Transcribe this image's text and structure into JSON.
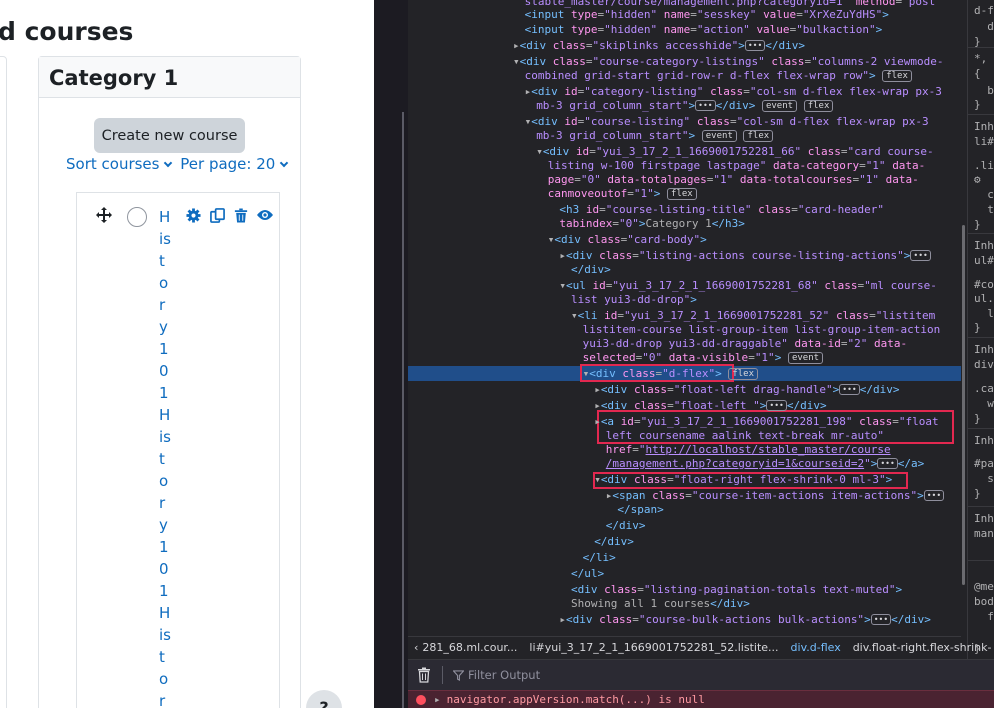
{
  "page": {
    "heading": "d courses",
    "category_title": "Category 1",
    "create_button": "Create new course",
    "sort_label": "Sort courses",
    "perpage_label": "Per page: 20",
    "course_name_chars": [
      "H",
      "is",
      "t",
      "o",
      "r",
      "y",
      "1",
      "0",
      "1",
      "H",
      "is",
      "t",
      "o",
      "r",
      "y",
      "1",
      "0",
      "1",
      "H",
      "is",
      "t",
      "o",
      "r"
    ],
    "help_label": "?"
  },
  "devtools": {
    "lines": [
      {
        "t": -5,
        "i": 11,
        "h": "<span class='val'>stable_master/course/management.php?categoryid=1</span>\" <span class='attr'>method</span>=<span class='val'>\"post\"</span>"
      },
      {
        "t": 8,
        "i": 11,
        "h": "<span class='tag'>&lt;input</span> <span class='attr'>type</span>=<span class='val'>\"hidden\"</span> <span class='attr'>name</span>=<span class='val'>\"sesskey\"</span> <span class='attr'>value</span>=<span class='val'>\"XrXeZuYdHS\"</span><span class='tag'>&gt;</span>"
      },
      {
        "t": 23,
        "i": 11,
        "h": "<span class='tag'>&lt;input</span> <span class='attr'>type</span>=<span class='val'>\"hidden\"</span> <span class='attr'>name</span>=<span class='val'>\"action\"</span> <span class='attr'>value</span>=<span class='val'>\"bulkaction\"</span><span class='tag'>&gt;</span>"
      },
      {
        "t": 39,
        "i": 10,
        "h": "<span class='tri'>▸</span><span class='tag'>&lt;div</span> <span class='attr'>class</span>=<span class='val'>\"skiplinks accesshide\"</span><span class='tag'>&gt;</span><span class='dots'>•••</span><span class='tag'>&lt;/div&gt;</span>"
      },
      {
        "t": 55,
        "i": 10,
        "h": "<span class='tri'>▾</span><span class='tag'>&lt;div</span> <span class='attr'>class</span>=<span class='val'>\"course-category-listings\"</span> <span class='attr'>class</span>=<span class='val'>\"columns-2 viewmode-</span>"
      },
      {
        "t": 69,
        "i": 11,
        "h": "<span class='val'>combined grid-start grid-row-r d-flex flex-wrap row\"</span><span class='tag'>&gt;</span> <span class='badge'>flex</span>"
      },
      {
        "t": 85,
        "i": 11,
        "h": "<span class='tri'>▸</span><span class='tag'>&lt;div</span> <span class='attr'>id</span>=<span class='val'>\"category-listing\"</span> <span class='attr'>class</span>=<span class='val'>\"col-sm d-flex flex-wrap px-3</span>"
      },
      {
        "t": 99,
        "i": 12,
        "h": "<span class='val'>mb-3 grid_column_start\"</span><span class='tag'>&gt;</span><span class='dots'>•••</span><span class='tag'>&lt;/div&gt;</span> <span class='badge'>event</span> <span class='badge'>flex</span>"
      },
      {
        "t": 115,
        "i": 11,
        "h": "<span class='tri'>▾</span><span class='tag'>&lt;div</span> <span class='attr'>id</span>=<span class='val'>\"course-listing\"</span> <span class='attr'>class</span>=<span class='val'>\"col-sm d-flex flex-wrap px-3</span>"
      },
      {
        "t": 129,
        "i": 12,
        "h": "<span class='val'>mb-3 grid_column_start\"</span><span class='tag'>&gt;</span> <span class='badge'>event</span> <span class='badge'>flex</span>"
      },
      {
        "t": 145,
        "i": 12,
        "h": "<span class='tri'>▾</span><span class='tag'>&lt;div</span> <span class='attr'>id</span>=<span class='val'>\"yui_3_17_2_1_1669001752281_66\"</span> <span class='attr'>class</span>=<span class='val'>\"card course-</span>"
      },
      {
        "t": 159,
        "i": 13,
        "h": "<span class='val'>listing w-100 firstpage lastpage\"</span> <span class='attr'>data-category</span>=<span class='val'>\"1\"</span> <span class='attr'>data-</span>"
      },
      {
        "t": 173,
        "i": 13,
        "h": "<span class='attr'>page</span>=<span class='val'>\"0\"</span> <span class='attr'>data-totalpages</span>=<span class='val'>\"1\"</span> <span class='attr'>data-totalcourses</span>=<span class='val'>\"1\"</span> <span class='attr'>data-</span>"
      },
      {
        "t": 187,
        "i": 13,
        "h": "<span class='attr'>canmoveoutof</span>=<span class='val'>\"1\"</span><span class='tag'>&gt;</span> <span class='badge'>flex</span>"
      },
      {
        "t": 203,
        "i": 14,
        "h": "<span class='tag'>&lt;h3</span> <span class='attr'>id</span>=<span class='val'>\"course-listing-title\"</span> <span class='attr'>class</span>=<span class='val'>\"card-header\"</span>"
      },
      {
        "t": 217,
        "i": 14,
        "h": "<span class='attr'>tabindex</span>=<span class='val'>\"0\"</span><span class='tag'>&gt;</span>Category 1<span class='tag'>&lt;/h3&gt;</span>"
      },
      {
        "t": 233,
        "i": 13,
        "h": "<span class='tri'>▾</span><span class='tag'>&lt;div</span> <span class='attr'>class</span>=<span class='val'>\"card-body\"</span><span class='tag'>&gt;</span>"
      },
      {
        "t": 249,
        "i": 14,
        "h": "<span class='tri'>▸</span><span class='tag'>&lt;div</span> <span class='attr'>class</span>=<span class='val'>\"listing-actions course-listing-actions\"</span><span class='tag'>&gt;</span><span class='dots'>•••</span>"
      },
      {
        "t": 263,
        "i": 15,
        "h": "<span class='tag'>&lt;/div&gt;</span>"
      },
      {
        "t": 279,
        "i": 14,
        "h": "<span class='tri'>▾</span><span class='tag'>&lt;ul</span> <span class='attr'>id</span>=<span class='val'>\"yui_3_17_2_1_1669001752281_68\"</span> <span class='attr'>class</span>=<span class='val'>\"ml course-</span>"
      },
      {
        "t": 293,
        "i": 15,
        "h": "<span class='val'>list yui3-dd-drop\"</span><span class='tag'>&gt;</span>"
      },
      {
        "t": 309,
        "i": 15,
        "h": "<span class='tri'>▾</span><span class='tag'>&lt;li</span> <span class='attr'>id</span>=<span class='val'>\"yui_3_17_2_1_1669001752281_52\"</span> <span class='attr'>class</span>=<span class='val'>\"listitem</span>"
      },
      {
        "t": 323,
        "i": 16,
        "h": "<span class='val'>listitem-course list-group-item list-group-item-action</span>"
      },
      {
        "t": 337,
        "i": 16,
        "h": "<span class='val'>yui3-dd-drop yui3-dd-draggable\"</span> <span class='attr'>data-id</span>=<span class='val'>\"2\"</span> <span class='attr'>data-</span>"
      },
      {
        "t": 351,
        "i": 16,
        "h": "<span class='attr'>selected</span>=<span class='val'>\"0\"</span> <span class='attr'>data-visible</span>=<span class='val'>\"1\"</span><span class='tag'>&gt;</span> <span class='badge'>event</span>"
      },
      {
        "t": 367,
        "i": 16,
        "h": "<span class='tri'>▾</span><span class='tag'>&lt;div</span> <span class='attr'>class</span>=<span class='val'>\"d-flex\"</span><span class='tag'>&gt;</span> <span class='badge'>flex</span>"
      },
      {
        "t": 383,
        "i": 17,
        "h": "<span class='tri'>▸</span><span class='tag'>&lt;div</span> <span class='attr'>class</span>=<span class='val'>\"float-left drag-handle\"</span><span class='tag'>&gt;</span><span class='dots'>•••</span><span class='tag'>&lt;/div&gt;</span>"
      },
      {
        "t": 399,
        "i": 17,
        "h": "<span class='tri'>▸</span><span class='tag'>&lt;div</span> <span class='attr'>class</span>=<span class='val'>\"float-left \"</span><span class='tag'>&gt;</span><span class='dots'>•••</span><span class='tag'>&lt;/div&gt;</span>"
      },
      {
        "t": 415,
        "i": 17,
        "h": "<span class='tri'>▸</span><span class='tag'>&lt;a</span> <span class='attr'>id</span>=<span class='val'>\"yui_3_17_2_1_1669001752281_198\"</span> <span class='attr'>class</span>=<span class='val'>\"float</span>"
      },
      {
        "t": 429,
        "i": 18,
        "h": "<span class='val'>left coursename aalink text-break mr-auto\"</span>"
      },
      {
        "t": 443,
        "i": 18,
        "h": "<span class='attr'>href</span>=<span class='val'>\"<u>http://localhost/stable_master/course</u></span>"
      },
      {
        "t": 457,
        "i": 18,
        "h": "<span class='val'><u>/management.php?categoryid=1&amp;courseid=2</u>\"</span><span class='tag'>&gt;</span><span class='dots'>•••</span><span class='tag'>&lt;/a&gt;</span>"
      },
      {
        "t": 473,
        "i": 17,
        "h": "<span class='tri'>▾</span><span class='tag'>&lt;div</span> <span class='attr'>class</span>=<span class='val'>\"float-right flex-shrink-0 ml-3\"</span><span class='tag'>&gt;</span>"
      },
      {
        "t": 489,
        "i": 18,
        "h": "<span class='tri'>▸</span><span class='tag'>&lt;span</span> <span class='attr'>class</span>=<span class='val'>\"course-item-actions item-actions\"</span><span class='tag'>&gt;</span><span class='dots'>•••</span>"
      },
      {
        "t": 503,
        "i": 19,
        "h": "<span class='tag'>&lt;/span&gt;</span>"
      },
      {
        "t": 519,
        "i": 18,
        "h": "<span class='tag'>&lt;/div&gt;</span>"
      },
      {
        "t": 535,
        "i": 17,
        "h": "<span class='tag'>&lt;/div&gt;</span>"
      },
      {
        "t": 551,
        "i": 16,
        "h": "<span class='tag'>&lt;/li&gt;</span>"
      },
      {
        "t": 567,
        "i": 15,
        "h": "<span class='tag'>&lt;/ul&gt;</span>"
      },
      {
        "t": 583,
        "i": 15,
        "h": "<span class='tag'>&lt;div</span> <span class='attr'>class</span>=<span class='val'>\"listing-pagination-totals text-muted\"</span><span class='tag'>&gt;</span>"
      },
      {
        "t": 597,
        "i": 15,
        "h": "<span class='txt'>Showing all 1 courses</span><span class='tag'>&lt;/div&gt;</span>"
      },
      {
        "t": 613,
        "i": 14,
        "h": "<span class='tri'>▸</span><span class='tag'>&lt;div</span> <span class='attr'>class</span>=<span class='val'>\"course-bulk-actions bulk-actions\"</span><span class='tag'>&gt;</span><span class='dots'>•••</span><span class='tag'>&lt;/div&gt;</span>"
      }
    ],
    "breadcrumbs": [
      "‹",
      "281_68.ml.cour...",
      "li#yui_3_17_2_1_1669001752281_52.listite...",
      "div.d-flex",
      "div.float-right.flex-shrink-",
      "›"
    ],
    "filter_placeholder": "Filter Output",
    "console_error": "navigator.appVersion.match(...) is null",
    "rules": [
      {
        "t": 4,
        "x": "d-f"
      },
      {
        "t": 20,
        "x": "  d"
      },
      {
        "t": 35,
        "x": "}"
      },
      {
        "t": 52,
        "x": "*, :"
      },
      {
        "t": 67,
        "x": "{"
      },
      {
        "t": 84,
        "x": "  b"
      },
      {
        "t": 98,
        "x": "}"
      },
      {
        "t": 120,
        "x": "Inher"
      },
      {
        "t": 135,
        "x": "li#yu"
      },
      {
        "t": 159,
        "x": ".lis"
      },
      {
        "t": 173,
        "x": "⚙ "
      },
      {
        "t": 188,
        "x": "  c"
      },
      {
        "t": 203,
        "x": "  t"
      },
      {
        "t": 218,
        "x": "}"
      },
      {
        "t": 239,
        "x": "Inher"
      },
      {
        "t": 254,
        "x": "ul#yu"
      },
      {
        "t": 278,
        "x": "#cou"
      },
      {
        "t": 292,
        "x": "ul.m"
      },
      {
        "t": 307,
        "x": "  l"
      },
      {
        "t": 321,
        "x": "}"
      },
      {
        "t": 343,
        "x": "Inher"
      },
      {
        "t": 358,
        "x": "div#y"
      },
      {
        "t": 382,
        "x": ".car"
      },
      {
        "t": 397,
        "x": "  w"
      },
      {
        "t": 412,
        "x": "}"
      },
      {
        "t": 434,
        "x": "Inher"
      },
      {
        "t": 457,
        "x": "#pag"
      },
      {
        "t": 472,
        "x": "  s"
      },
      {
        "t": 487,
        "x": "}"
      },
      {
        "t": 512,
        "x": "Inher"
      },
      {
        "t": 527,
        "x": "mana"
      },
      {
        "t": 580,
        "x": "@med"
      },
      {
        "t": 595,
        "x": "body"
      },
      {
        "t": 610,
        "x": "  f"
      },
      {
        "t": 642,
        "x": "}"
      }
    ]
  },
  "colors": {
    "link": "#0f6cbf",
    "devtools_bg": "#232327",
    "selection": "#204e8a",
    "highlight_box": "#e22850"
  }
}
